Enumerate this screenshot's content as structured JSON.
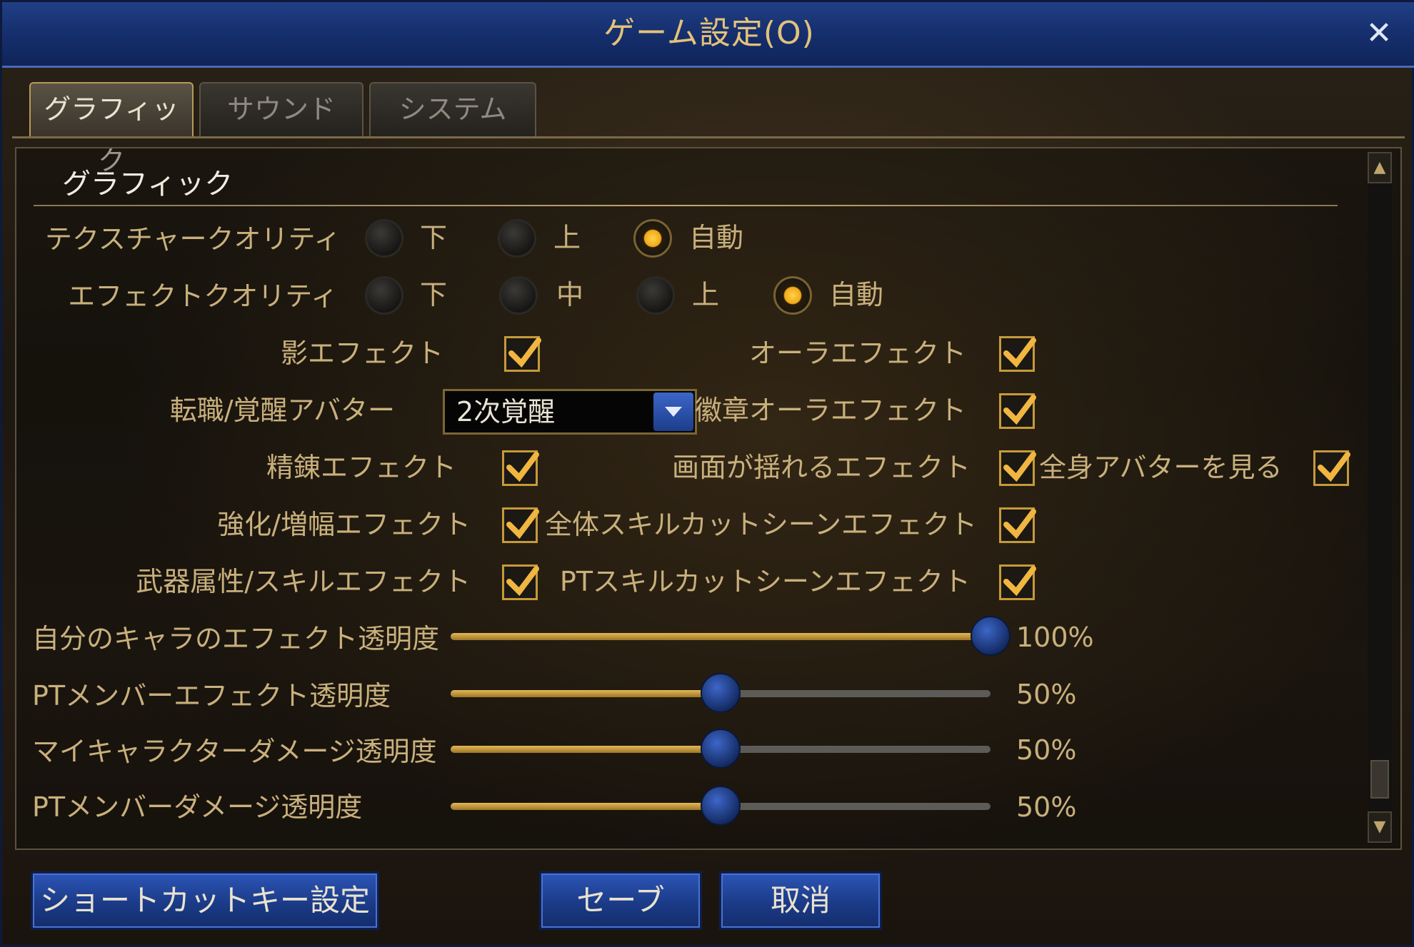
{
  "window": {
    "title": "ゲーム設定(O)"
  },
  "tabs": [
    {
      "label": "グラフィック",
      "active": true
    },
    {
      "label": "サウンド",
      "active": false
    },
    {
      "label": "システム",
      "active": false
    }
  ],
  "section": {
    "title": "グラフィック"
  },
  "texture_quality": {
    "label": "テクスチャークオリティ",
    "options": [
      "下",
      "上",
      "自動"
    ],
    "selected": "自動"
  },
  "effect_quality": {
    "label": "エフェクトクオリティ",
    "options": [
      "下",
      "中",
      "上",
      "自動"
    ],
    "selected": "自動"
  },
  "checkboxes": {
    "shadow_effect": {
      "label": "影エフェクト",
      "checked": true
    },
    "aura_effect": {
      "label": "オーラエフェクト",
      "checked": true
    },
    "emblem_aura_effect": {
      "label": "徽章オーラエフェクト",
      "checked": true
    },
    "refine_effect": {
      "label": "精錬エフェクト",
      "checked": true
    },
    "screen_shake_effect": {
      "label": "画面が揺れるエフェクト",
      "checked": true
    },
    "full_avatar": {
      "label": "全身アバターを見る",
      "checked": true
    },
    "enhance_effect": {
      "label": "強化/増幅エフェクト",
      "checked": true
    },
    "all_skill_cutscene": {
      "label": "全体スキルカットシーンエフェクト",
      "checked": true
    },
    "weapon_skill_effect": {
      "label": "武器属性/スキルエフェクト",
      "checked": true
    },
    "pt_skill_cutscene": {
      "label": "PTスキルカットシーンエフェクト",
      "checked": true
    }
  },
  "avatar_dropdown": {
    "label": "転職/覚醒アバター",
    "value": "2次覚醒"
  },
  "sliders": [
    {
      "label": "自分のキャラのエフェクト透明度",
      "value": 100,
      "value_text": "100%"
    },
    {
      "label": "PTメンバーエフェクト透明度",
      "value": 50,
      "value_text": "50%"
    },
    {
      "label": "マイキャラクターダメージ透明度",
      "value": 50,
      "value_text": "50%"
    },
    {
      "label": "PTメンバーダメージ透明度",
      "value": 50,
      "value_text": "50%"
    }
  ],
  "buttons": {
    "shortcut": "ショートカットキー設定",
    "save": "セーブ",
    "cancel": "取消"
  },
  "icons": {
    "close": "close-icon",
    "check": "checkmark-icon",
    "dropdown": "chevron-down-icon",
    "scroll_up": "chevron-up-icon",
    "scroll_down": "chevron-down-icon"
  },
  "colors": {
    "accent_gold": "#c9b07c",
    "title_blue": "#16306f",
    "radio_selected": "#f1a81a"
  }
}
